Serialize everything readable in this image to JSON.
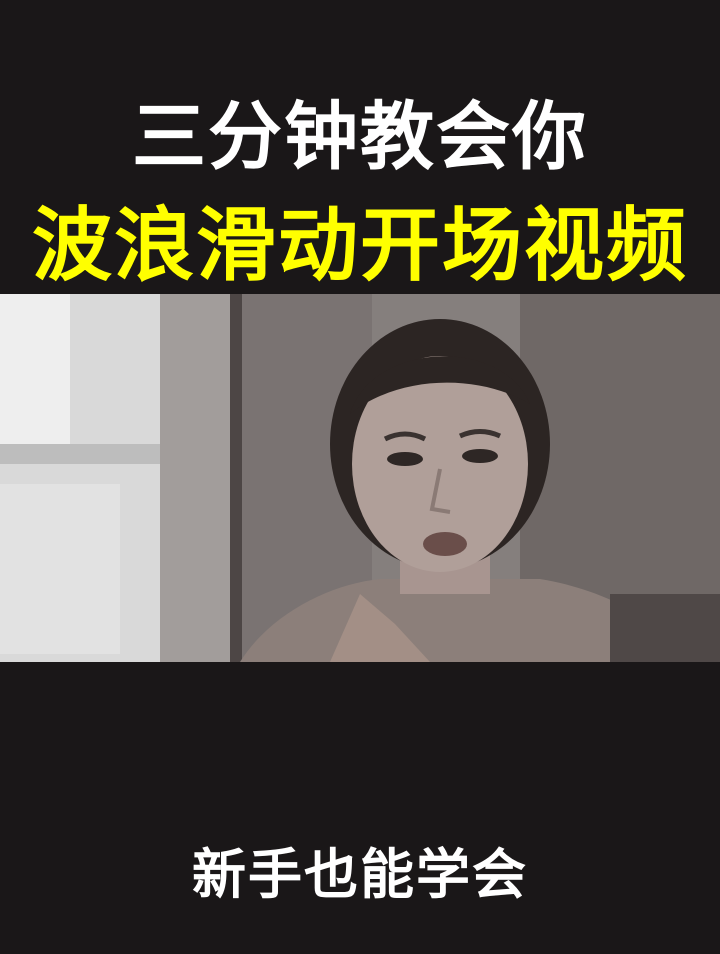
{
  "headline": {
    "line1": "三分钟教会你",
    "line2": "波浪滑动开场视频"
  },
  "caption": "新手也能学会",
  "colors": {
    "background": "#1a1718",
    "headline_line1": "#ffffff",
    "headline_line2": "#ffff00",
    "caption": "#ffffff"
  }
}
